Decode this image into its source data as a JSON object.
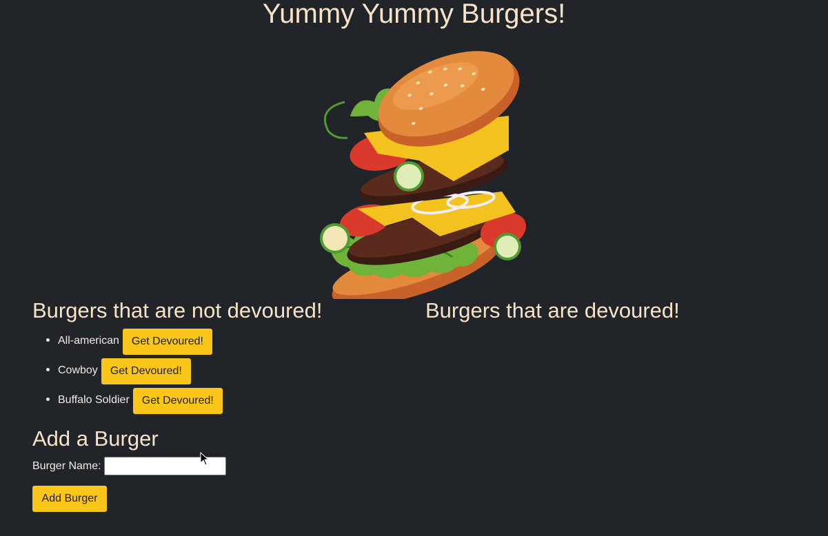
{
  "header": {
    "title": "Yummy Yummy Burgers!"
  },
  "hero_image": {
    "icon": "burger-illustration"
  },
  "not_devoured": {
    "heading": "Burgers that are not devoured!",
    "items": [
      {
        "name": "All-american",
        "button_label": "Get Devoured!"
      },
      {
        "name": "Cowboy",
        "button_label": "Get Devoured!"
      },
      {
        "name": "Buffalo Soldier",
        "button_label": "Get Devoured!"
      }
    ]
  },
  "devoured": {
    "heading": "Burgers that are devoured!",
    "items": []
  },
  "add_form": {
    "heading": "Add a Burger",
    "name_label": "Burger Name:",
    "name_value": "",
    "submit_label": "Add Burger"
  },
  "colors": {
    "background": "#212428",
    "heading_text": "#f9e3c8",
    "button": "#fbc61a"
  }
}
